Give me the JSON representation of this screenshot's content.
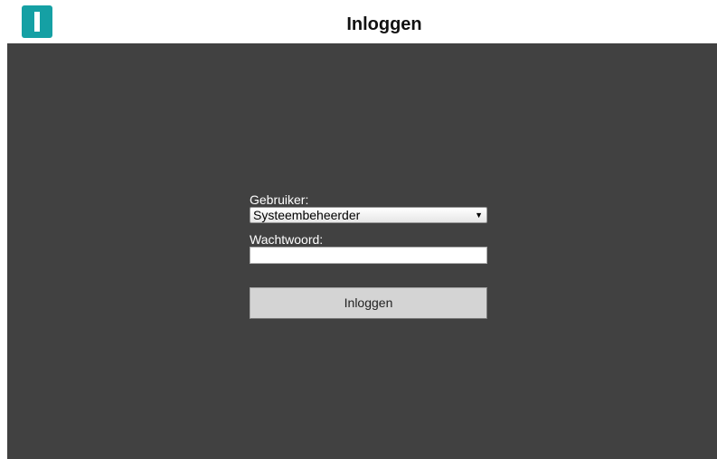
{
  "header": {
    "title": "Inloggen",
    "logo_icon": "app-logo-icon"
  },
  "colors": {
    "accent": "#15a0a4",
    "panel_background": "#414141",
    "button_background": "#d4d4d4"
  },
  "form": {
    "user_label": "Gebruiker:",
    "user_selected": "Systeembeheerder",
    "password_label": "Wachtwoord:",
    "password_value": "",
    "login_button_label": "Inloggen"
  }
}
